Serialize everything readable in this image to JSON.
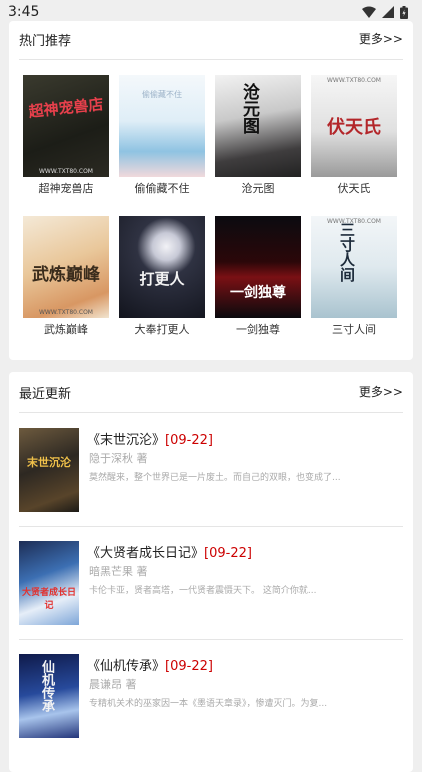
{
  "status_bar": {
    "time": "3:45"
  },
  "hot": {
    "title": "热门推荐",
    "more": "更多>>",
    "books": [
      {
        "name": "超神宠兽店",
        "cover_text": "超神宠兽店",
        "cover_foot": "WWW.TXT80.COM"
      },
      {
        "name": "偷偷藏不住",
        "cover_text": "偷偷藏不住",
        "cover_foot": ""
      },
      {
        "name": "沧元图",
        "cover_text": "沧元图",
        "cover_foot": ""
      },
      {
        "name": "伏天氏",
        "cover_text": "伏天氏",
        "cover_foot": "WWW.TXT80.COM"
      },
      {
        "name": "武炼巅峰",
        "cover_text": "武炼巅峰",
        "cover_foot": "WWW.TXT80.COM"
      },
      {
        "name": "大奉打更人",
        "cover_text": "打更人",
        "cover_foot": ""
      },
      {
        "name": "一剑独尊",
        "cover_text": "一剑独尊",
        "cover_foot": ""
      },
      {
        "name": "三寸人间",
        "cover_text": "三寸人间",
        "cover_foot": "WWW.TXT80.COM"
      }
    ]
  },
  "recent": {
    "title": "最近更新",
    "more": "更多>>",
    "items": [
      {
        "title": "《末世沉沦》",
        "date": "[09-22]",
        "author": "隐于深秋 著",
        "desc": "莫然醒来，整个世界已是一片废土。而自己的双眼，也变成了...",
        "cover_text": "末世沉沦"
      },
      {
        "title": "《大贤者成长日记》",
        "date": "[09-22]",
        "author": "暗黑芒果 著",
        "desc": "卡伦卡亚，贤者高塔，一代贤者震慑天下。 这简介你就...",
        "cover_text": "大贤者成长日记"
      },
      {
        "title": "《仙机传承》",
        "date": "[09-22]",
        "author": "晨谦昂 著",
        "desc": "专精机关术的巫家因一本《墨语天章录》，惨遭灭门。为复...",
        "cover_text": "仙机传承"
      }
    ]
  }
}
